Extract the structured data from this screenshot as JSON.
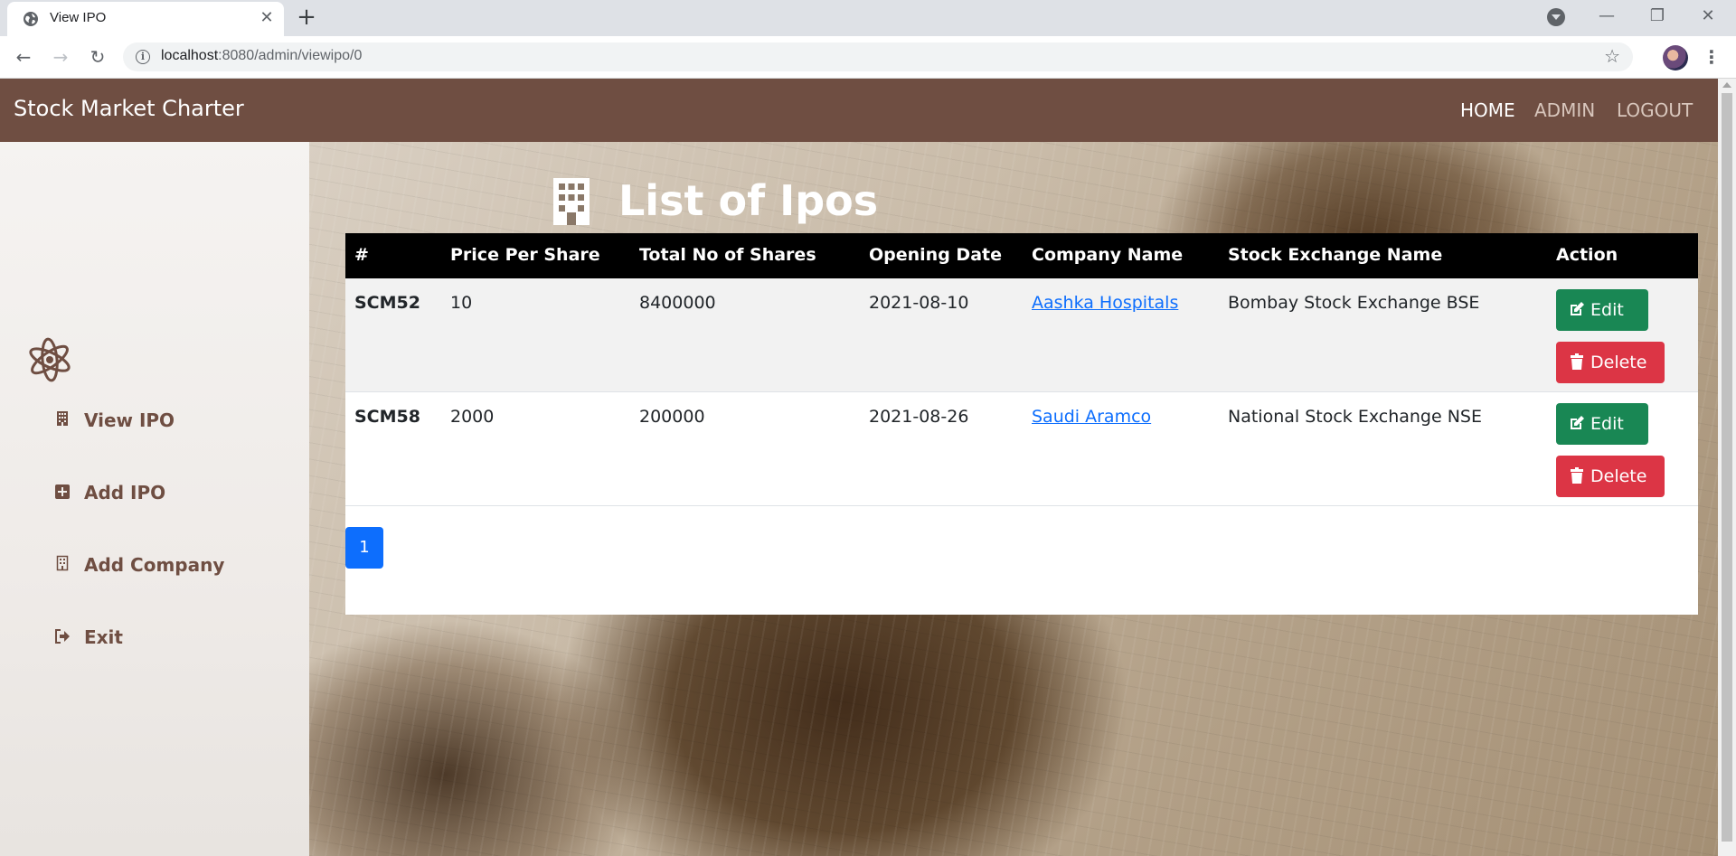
{
  "browser": {
    "tab_title": "View IPO",
    "tab_close": "✕",
    "new_tab": "+",
    "url_host": "localhost",
    "url_path": ":8080/admin/viewipo/0",
    "window_minimize": "—",
    "window_restore": "❐",
    "window_close": "✕"
  },
  "navbar": {
    "brand": "Stock Market Charter",
    "links": [
      "HOME",
      "ADMIN",
      "LOGOUT"
    ]
  },
  "sidebar": {
    "items": [
      {
        "label": "View IPO",
        "icon": "building-icon"
      },
      {
        "label": "Add IPO",
        "icon": "plus-square-icon"
      },
      {
        "label": "Add Company",
        "icon": "building-outline-icon"
      },
      {
        "label": "Exit",
        "icon": "sign-out-icon"
      }
    ]
  },
  "main": {
    "title": "List of Ipos",
    "table": {
      "headers": [
        "#",
        "Price Per Share",
        "Total No of Shares",
        "Opening Date",
        "Company Name",
        "Stock Exchange Name",
        "Action"
      ],
      "rows": [
        {
          "id": "SCM52",
          "price": "10",
          "shares": "8400000",
          "date": "2021-08-10",
          "company": "Aashka Hospitals",
          "exchange": "Bombay Stock Exchange BSE"
        },
        {
          "id": "SCM58",
          "price": "2000",
          "shares": "200000",
          "date": "2021-08-26",
          "company": "Saudi Aramco",
          "exchange": "National Stock Exchange NSE"
        }
      ],
      "edit_label": "Edit",
      "delete_label": "Delete"
    },
    "pagination": {
      "current": "1"
    }
  },
  "colors": {
    "navbar": "#6f4e42",
    "edit": "#198754",
    "delete": "#dc3545",
    "page": "#0d6efd"
  }
}
